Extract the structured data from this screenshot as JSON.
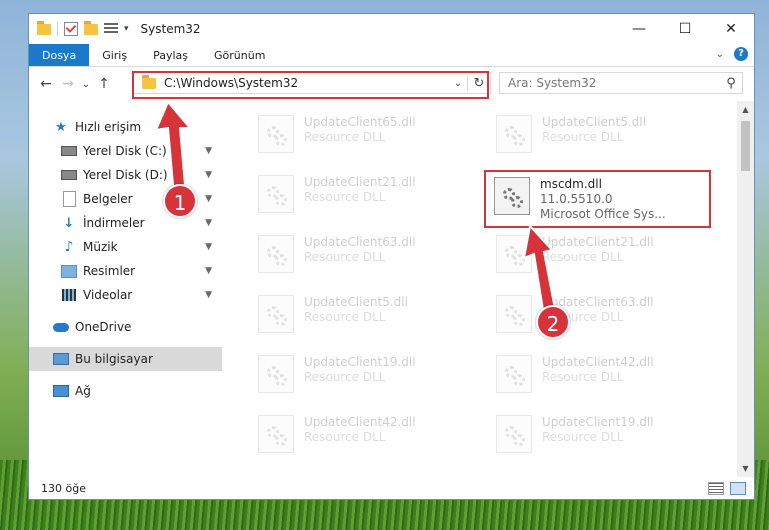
{
  "window": {
    "title": "System32",
    "qa_dropdown": "▾",
    "buttons": {
      "minimize": "—",
      "maximize": "☐",
      "close": "✕"
    }
  },
  "ribbon": {
    "tabs": [
      "Dosya",
      "Giriş",
      "Paylaş",
      "Görünüm"
    ],
    "expand": "⌄",
    "help": "?"
  },
  "nav": {
    "back": "←",
    "forward": "→",
    "recent": "⌄",
    "up": "↑"
  },
  "address": {
    "path": "C:\\Windows\\System32",
    "dropdown": "⌄",
    "refresh": "↻"
  },
  "search": {
    "placeholder": "Ara: System32",
    "icon": "⚲"
  },
  "sidebar": {
    "quick_access": "Hızlı erişim",
    "items": [
      {
        "label": "Yerel Disk (C:)",
        "icon": "drive-icon"
      },
      {
        "label": "Yerel Disk (D:)",
        "icon": "drive-icon"
      },
      {
        "label": "Belgeler",
        "icon": "documents-icon"
      },
      {
        "label": "İndirmeler",
        "icon": "download-icon"
      },
      {
        "label": "Müzik",
        "icon": "music-icon"
      },
      {
        "label": "Resimler",
        "icon": "pictures-icon"
      },
      {
        "label": "Videolar",
        "icon": "videos-icon"
      }
    ],
    "pin": "📌",
    "onedrive": "OneDrive",
    "this_pc": "Bu bilgisayar",
    "network": "Ağ"
  },
  "files": {
    "left": [
      {
        "name": "UpdateClient65.dll",
        "desc": "Resource DLL"
      },
      {
        "name": "UpdateClient21.dll",
        "desc": "Resource DLL"
      },
      {
        "name": "UpdateClient63.dll",
        "desc": "Resource DLL"
      },
      {
        "name": "UpdateClient5.dll",
        "desc": "Resource DLL"
      },
      {
        "name": "UpdateClient19.dll",
        "desc": "Resource DLL"
      },
      {
        "name": "UpdateClient42.dll",
        "desc": "Resource DLL"
      }
    ],
    "right": [
      {
        "name": "UpdateClient5.dll",
        "desc": "Resource DLL"
      },
      {
        "name": "UpdateClient21.dll",
        "desc": "Resource DLL"
      },
      {
        "name": "UpdateClient63.dll",
        "desc": "Resource DLL"
      },
      {
        "name": "UpdateClient42.dll",
        "desc": "Resource DLL"
      },
      {
        "name": "UpdateClient19.dll",
        "desc": "Resource DLL"
      }
    ],
    "highlight": {
      "name": "mscdm.dll",
      "version": "11.0.5510.0",
      "company": "Microsot Office Sys..."
    }
  },
  "status": {
    "count": "130 öğe"
  },
  "annotations": {
    "step1": "1",
    "step2": "2",
    "color": "#d6333b"
  }
}
